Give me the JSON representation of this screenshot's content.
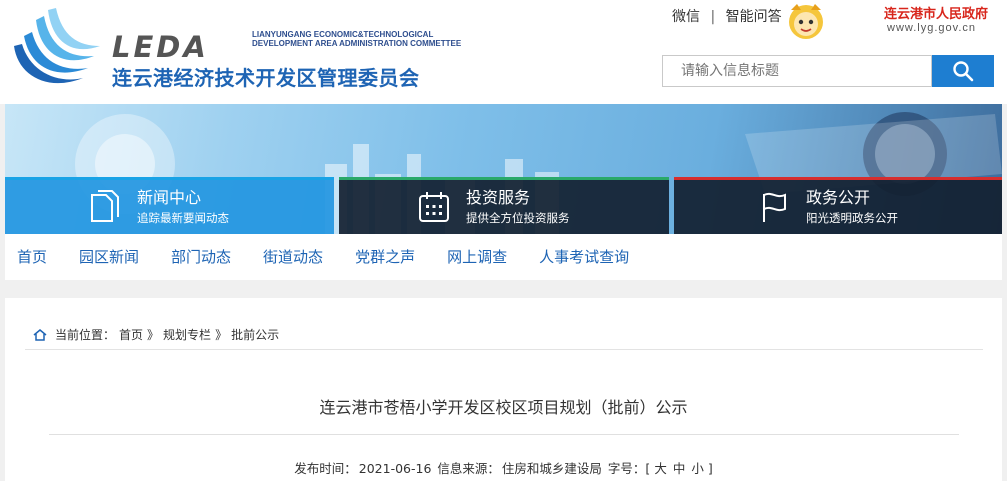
{
  "header": {
    "logo_wordmark": "LEDA",
    "logo_en_line1": "LIANYUNGANG ECONOMIC&TECHNOLOGICAL",
    "logo_en_line2": "DEVELOPMENT AREA ADMINISTRATION COMMETTEE",
    "logo_cn": "连云港经济技术开发区管理委员会",
    "top_links": [
      "微信",
      "智能问答"
    ],
    "separator": "|",
    "gov_name": "连云港市人民政府",
    "gov_url": "www.lyg.gov.cn",
    "search_placeholder": "请输入信息标题",
    "search_icon": "search-icon"
  },
  "services": [
    {
      "title": "新闻中心",
      "subtitle": "追踪最新要闻动态",
      "icon": "document-icon"
    },
    {
      "title": "投资服务",
      "subtitle": "提供全方位投资服务",
      "icon": "calendar-icon"
    },
    {
      "title": "政务公开",
      "subtitle": "阳光透明政务公开",
      "icon": "flag-icon"
    }
  ],
  "nav": [
    "首页",
    "园区新闻",
    "部门动态",
    "街道动态",
    "党群之声",
    "网上调查",
    "人事考试查询"
  ],
  "breadcrumb": {
    "label": "当前位置：",
    "items": [
      "首页",
      "规划专栏",
      "批前公示"
    ],
    "separator": "》"
  },
  "article": {
    "title": "连云港市苍梧小学开发区校区项目规划（批前）公示",
    "publish_label": "发布时间：",
    "publish_date": "2021-06-16",
    "source_label": "信息来源：",
    "source": "住房和城乡建设局",
    "fontsize_label": "字号：[",
    "fontsize_large": "大",
    "fontsize_medium": "中",
    "fontsize_small": "小",
    "fontsize_end": "]"
  },
  "colors": {
    "brand_blue": "#1e64b4",
    "search_button": "#1e7ed1",
    "gov_red": "#d8261c"
  }
}
